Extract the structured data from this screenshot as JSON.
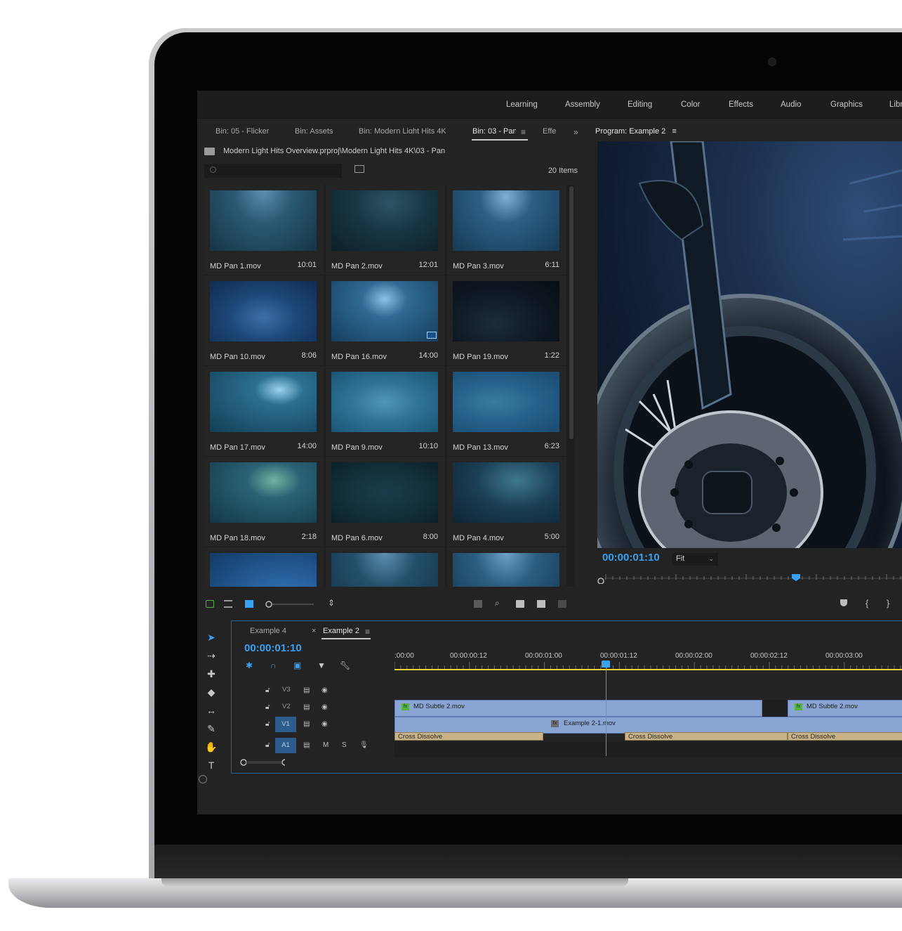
{
  "workspaces": [
    "Learning",
    "Assembly",
    "Editing",
    "Color",
    "Effects",
    "Audio",
    "Graphics",
    "Libr"
  ],
  "project": {
    "tabs": [
      "Bin: 05 - Flicker",
      "Bin: Assets",
      "Bin: Modern Light Hits 4K",
      "Bin: 03 - Pan",
      "Effe"
    ],
    "path": "Modern Light Hits Overview.prproj\\Modern Light Hits 4K\\03 - Pan",
    "search_placeholder": "",
    "items_count": "20 Items",
    "clips": [
      {
        "name": "MD Pan 1.mov",
        "duration": "10:01"
      },
      {
        "name": "MD Pan 2.mov",
        "duration": "12:01"
      },
      {
        "name": "MD Pan 3.mov",
        "duration": "6:11"
      },
      {
        "name": "MD Pan 10.mov",
        "duration": "8:06"
      },
      {
        "name": "MD Pan 16.mov",
        "duration": "14:00"
      },
      {
        "name": "MD Pan 19.mov",
        "duration": "1:22"
      },
      {
        "name": "MD Pan 17.mov",
        "duration": "14:00"
      },
      {
        "name": "MD Pan 9.mov",
        "duration": "10:10"
      },
      {
        "name": "MD Pan 13.mov",
        "duration": "6:23"
      },
      {
        "name": "MD Pan 18.mov",
        "duration": "2:18"
      },
      {
        "name": "MD Pan 6.mov",
        "duration": "8:00"
      },
      {
        "name": "MD Pan 4.mov",
        "duration": "5:00"
      }
    ]
  },
  "program": {
    "title": "Program: Example 2",
    "timecode": "00:00:01:10",
    "fit": "Fit"
  },
  "timeline": {
    "tabs": [
      "Example 4",
      "Example 2"
    ],
    "timecode": "00:00:01:10",
    "ruler": [
      ":00:00",
      "00:00:00:12",
      "00:00:01:00",
      "00:00:01:12",
      "00:00:02:00",
      "00:00:02:12",
      "00:00:03:00"
    ],
    "tracks": {
      "v3": "V3",
      "v2": "V2",
      "v1": "V1",
      "a1": "A1",
      "mute": "M",
      "solo": "S"
    },
    "clips": {
      "v2_a": "MD Subtle 2.mov",
      "v2_b": "MD Subtle 2.mov",
      "v1_nested": "Example 2-1.mov",
      "dissolve_1": "Cross Dissolve",
      "dissolve_2": "Cross Dissolve",
      "dissolve_3": "Cross Dissolve"
    }
  },
  "colors": {
    "accent_blue": "#3aa0f0",
    "clip_blue": "#8aa5d4",
    "dissolve_tan": "#c9b489",
    "work_area_yellow": "#e8d13a",
    "fx_green": "#58b04a"
  }
}
